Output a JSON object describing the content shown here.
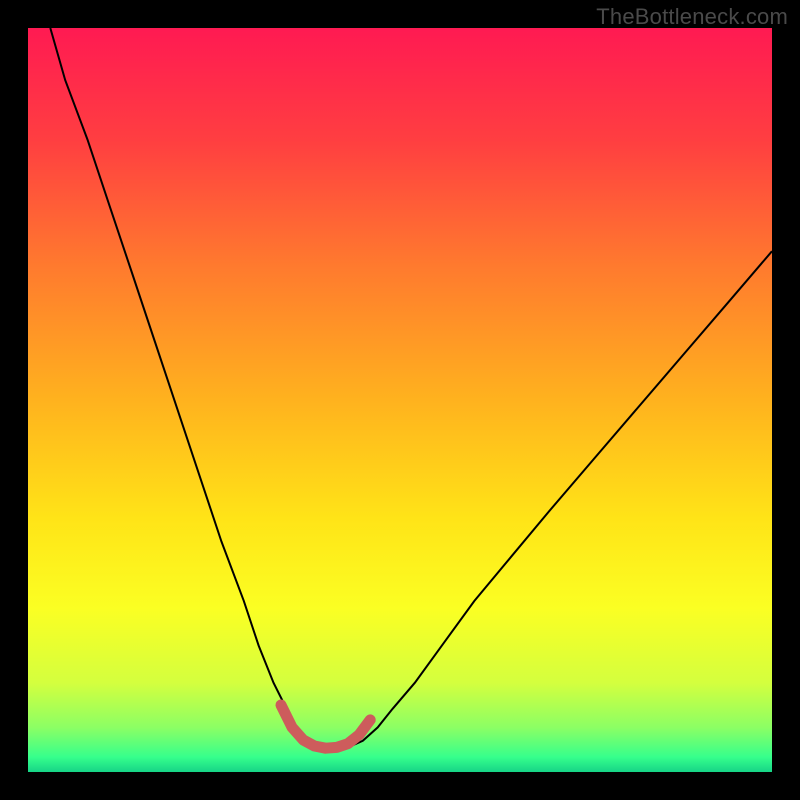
{
  "watermark": "TheBottleneck.com",
  "chart_data": {
    "type": "line",
    "title": "",
    "xlabel": "",
    "ylabel": "",
    "xlim": [
      0,
      100
    ],
    "ylim": [
      0,
      100
    ],
    "grid": false,
    "legend": false,
    "series": [
      {
        "name": "bottleneck-curve",
        "x": [
          3,
          5,
          8,
          11,
          14,
          17,
          20,
          23,
          26,
          29,
          31,
          33,
          35,
          36.5,
          38,
          39.5,
          41,
          43,
          45,
          47,
          49,
          52,
          56,
          60,
          65,
          70,
          76,
          82,
          88,
          94,
          100
        ],
        "y": [
          100,
          93,
          85,
          76,
          67,
          58,
          49,
          40,
          31,
          23,
          17,
          12,
          8,
          5,
          3.5,
          3,
          3,
          3.3,
          4.2,
          6,
          8.5,
          12,
          17.5,
          23,
          29,
          35,
          42,
          49,
          56,
          63,
          70
        ],
        "stroke": "#000000",
        "stroke_width": 2
      },
      {
        "name": "highlight-valley",
        "x": [
          34,
          35.5,
          37,
          38.5,
          40,
          41.5,
          43,
          44.5,
          46
        ],
        "y": [
          9,
          6,
          4.3,
          3.5,
          3.2,
          3.3,
          3.8,
          5,
          7
        ],
        "stroke": "#cd5c5c",
        "stroke_width": 11,
        "linecap": "round"
      }
    ],
    "background_gradient": {
      "type": "vertical",
      "stops": [
        {
          "offset": 0.0,
          "color": "#ff1a52"
        },
        {
          "offset": 0.15,
          "color": "#ff3e41"
        },
        {
          "offset": 0.32,
          "color": "#ff7a2e"
        },
        {
          "offset": 0.5,
          "color": "#ffb21e"
        },
        {
          "offset": 0.66,
          "color": "#ffe417"
        },
        {
          "offset": 0.78,
          "color": "#fbff23"
        },
        {
          "offset": 0.88,
          "color": "#d4ff3e"
        },
        {
          "offset": 0.94,
          "color": "#8cff64"
        },
        {
          "offset": 0.98,
          "color": "#36ff8c"
        },
        {
          "offset": 1.0,
          "color": "#16d487"
        }
      ]
    }
  }
}
